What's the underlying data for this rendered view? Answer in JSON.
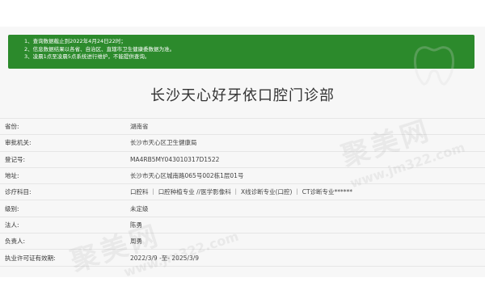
{
  "notice": {
    "lines": [
      "1、查询数据截止到2022年4月24日22时；",
      "2、信息数据结果以各省、自治区、直辖市卫生健康委数据为准。",
      "3、凌晨1点至凌晨5点系统进行维护，不能提供查询。"
    ]
  },
  "title": "长沙天心好牙依口腔门诊部",
  "rows": [
    {
      "label": "省份:",
      "value": "湖南省"
    },
    {
      "label": "审批机关:",
      "value": "长沙市天心区卫生健康局"
    },
    {
      "label": "登记号:",
      "value": "MA4RB5MY043010317D1522"
    },
    {
      "label": "地址:",
      "value": "长沙市天心区城南路065号002栋1层01号"
    },
    {
      "label": "诊疗科目:",
      "value": "口腔科 ｜ 口腔种植专业 //医学影像科 ｜ X线诊断专业(口腔) ｜ CT诊断专业******"
    },
    {
      "label": "级别:",
      "value": "未定级"
    },
    {
      "label": "法人:",
      "value": "陈勇"
    },
    {
      "label": "负责人:",
      "value": "周勇"
    },
    {
      "label": "执业许可证有效期:",
      "value": "2022/3/9 -至- 2025/3/9"
    }
  ]
}
